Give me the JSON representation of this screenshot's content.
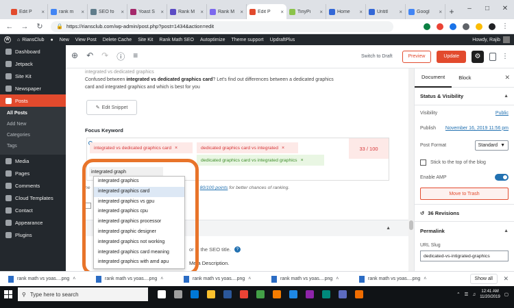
{
  "browser": {
    "tabs": [
      {
        "label": "Edit P",
        "color": "#e24a2d"
      },
      {
        "label": "rank m",
        "color": "#4285f4"
      },
      {
        "label": "SEO fo",
        "color": "#607d8b"
      },
      {
        "label": "Yoast S",
        "color": "#a4286a"
      },
      {
        "label": "Rank M",
        "color": "#5b4bc4"
      },
      {
        "label": "Rank M",
        "color": "#7b68ee"
      },
      {
        "label": "Edit P",
        "color": "#e24a2d",
        "active": true
      },
      {
        "label": "TinyPi",
        "color": "#8bc34a"
      },
      {
        "label": "Home",
        "color": "#3367d6"
      },
      {
        "label": "Untitl",
        "color": "#3367d6"
      },
      {
        "label": "Googl",
        "color": "#4285f4"
      }
    ],
    "url": "https://riansclub.com/wp-admin/post.php?post=1434&action=edit",
    "ext_colors": [
      "#0b8043",
      "#ea4335",
      "#1a73e8",
      "#5f6368",
      "#fbbc04",
      "#202124"
    ]
  },
  "adminbar": {
    "site": "RiansClub",
    "items": [
      "New",
      "View Post",
      "Delete Cache",
      "Site Kit",
      "Rank Math SEO",
      "Autoptimize",
      "Theme support",
      "UpdraftPlus"
    ],
    "howdy": "Howdy, Rajib"
  },
  "sidebar": {
    "items": [
      {
        "label": "Dashboard"
      },
      {
        "label": "Jetpack"
      },
      {
        "label": "Site Kit"
      },
      {
        "label": "Newspaper"
      }
    ],
    "posts_label": "Posts",
    "sub": [
      "All Posts",
      "Add New",
      "Categories",
      "Tags"
    ],
    "items2": [
      {
        "label": "Media"
      },
      {
        "label": "Pages"
      },
      {
        "label": "Comments"
      },
      {
        "label": "Cloud Templates"
      },
      {
        "label": "Contact"
      },
      {
        "label": "Appearance"
      },
      {
        "label": "Plugins"
      }
    ]
  },
  "editor": {
    "switch_to_draft": "Switch to Draft",
    "preview": "Preview",
    "update": "Update"
  },
  "content": {
    "intro_line1": "integrated vs dedicated graphics",
    "intro_pre": "Confused between ",
    "intro_bold": "integrated vs dedicated graphics card",
    "intro_post": "? Let's find out differences between a dedicated graphics",
    "intro_line3": "card and integrated graphics and which is best for you",
    "edit_snippet": "Edit Snippet",
    "focus_keyword_label": "Focus Keyword",
    "keywords": [
      {
        "text": "integrated vs dedicated graphics card",
        "status": "red"
      },
      {
        "text": "dedicated graphics card vs integrated",
        "status": "red"
      },
      {
        "text": "dedicated graphics card vs integrated graphics",
        "status": "green"
      }
    ],
    "score": "33 / 100",
    "keyword_input": "integrated graph",
    "hint_pre": "ne",
    "hint_link": "80/100 points",
    "hint_post": " for better chances of ranking.",
    "seo_title_hint": "or in the SEO title.",
    "meta_hint": "Meta Description."
  },
  "autocomplete": {
    "options": [
      "integrated graphics",
      "integrated graphics card",
      "integrated graphics vs gpu",
      "integrated graphics cpu",
      "integrated graphics processor",
      "integrated graphic designer",
      "integrated graphics not working",
      "integrated graphics card meaning",
      "integrated graphics with amd apu"
    ],
    "highlighted_index": 1
  },
  "settings": {
    "tab_document": "Document",
    "tab_block": "Block",
    "status_section": "Status & Visibility",
    "visibility_label": "Visibility",
    "visibility_value": "Public",
    "publish_label": "Publish",
    "publish_value": "November 16, 2019 11:56 pm",
    "post_format_label": "Post Format",
    "post_format_value": "Standard",
    "stick_label": "Stick to the top of the blog",
    "amp_label": "Enable AMP",
    "trash": "Move to Trash",
    "revisions": "36 Revisions",
    "permalink": "Permalink",
    "url_slug_label": "URL Slug",
    "url_slug_value": "dedicated-vs-intigrated-graphics"
  },
  "downloads": {
    "items": [
      "rank math vs yoas....png",
      "rank math vs yoas....png",
      "rank math vs yoas....png",
      "rank math vs yoas....png",
      "rank math vs yoas....png"
    ],
    "show_all": "Show all"
  },
  "taskbar": {
    "search_placeholder": "Type here to search",
    "time": "12:41 AM",
    "date": "11/20/2019",
    "icon_colors": [
      "#ffffff",
      "#9e9e9e",
      "#0078d7",
      "#fbc02d",
      "#2b579a",
      "#ea4335",
      "#43a047",
      "#f57c00",
      "#1e88e5",
      "#8e24aa",
      "#00897b",
      "#5c6bc0",
      "#ef6c00"
    ]
  }
}
